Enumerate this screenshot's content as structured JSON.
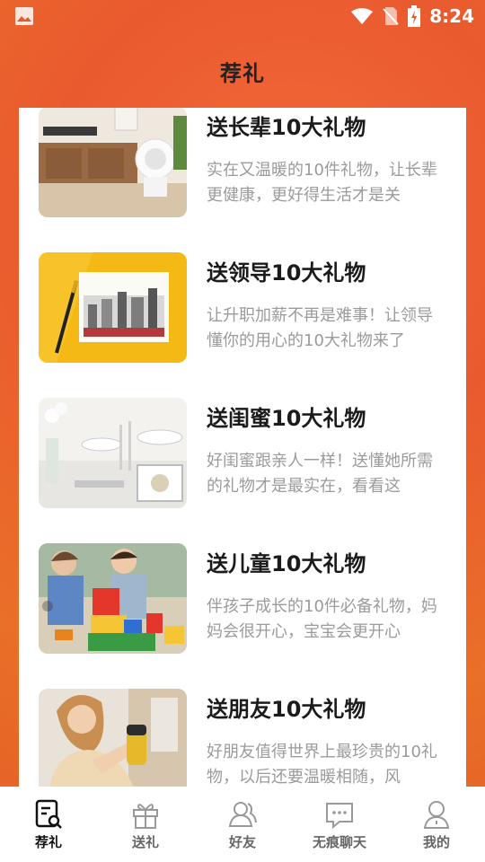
{
  "status_bar": {
    "time": "8:24"
  },
  "header": {
    "title": "荐礼"
  },
  "items": [
    {
      "title": "送长辈10大礼物",
      "desc": "实在又温暖的10件礼物，让长辈更健康，更好得生活才是关",
      "image": "elders-gift-image"
    },
    {
      "title": "送领导10大礼物",
      "desc": "让升职加薪不再是难事！让领导懂你的用心的10大礼物来了",
      "image": "leader-gift-image"
    },
    {
      "title": "送闺蜜10大礼物",
      "desc": "好闺蜜跟亲人一样！送懂她所需的礼物才是最实在，看看这",
      "image": "bestie-gift-image"
    },
    {
      "title": "送儿童10大礼物",
      "desc": "伴孩子成长的10件必备礼物，妈妈会很开心，宝宝会更开心",
      "image": "kids-gift-image"
    },
    {
      "title": "送朋友10大礼物",
      "desc": "好朋友值得世界上最珍贵的10礼物，以后还要温暖相随，风",
      "image": "friend-gift-image"
    }
  ],
  "nav": [
    {
      "label": "荐礼",
      "icon": "recommend-icon",
      "active": true
    },
    {
      "label": "送礼",
      "icon": "gift-icon",
      "active": false
    },
    {
      "label": "好友",
      "icon": "friends-icon",
      "active": false
    },
    {
      "label": "无痕聊天",
      "icon": "chat-icon",
      "active": false
    },
    {
      "label": "我的",
      "icon": "profile-icon",
      "active": false
    }
  ],
  "colors": {
    "accent": "#ea5a2f",
    "title": "#1b1b1b",
    "desc": "#9b9b9b"
  }
}
